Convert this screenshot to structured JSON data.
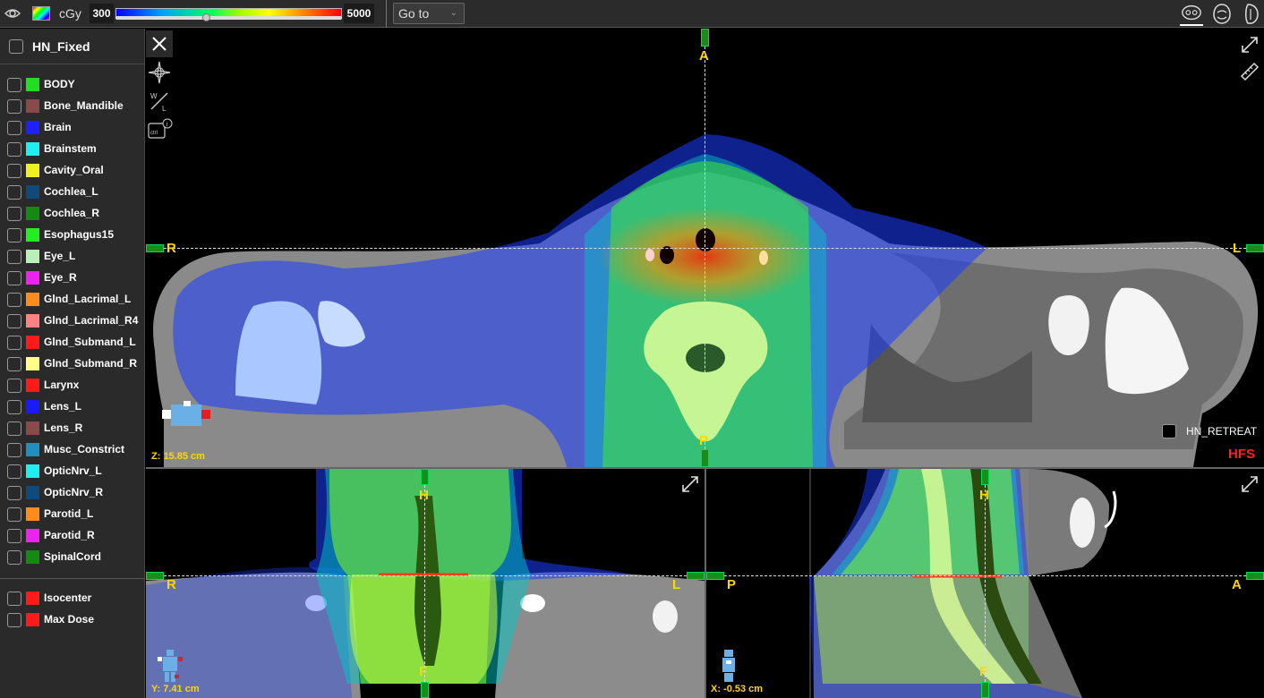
{
  "toolbar": {
    "unit": "cGy",
    "dose_min": "300",
    "dose_max": "5000",
    "slider_fraction": 0.4,
    "goto_label": "Go to",
    "view_icons": [
      "axial-view-icon",
      "coronal-view-icon",
      "sagittal-view-icon"
    ]
  },
  "sidebar": {
    "plan_name": "HN_Fixed",
    "structures": [
      {
        "label": "BODY",
        "color": "#22dd22"
      },
      {
        "label": "Bone_Mandible",
        "color": "#8b4a4a"
      },
      {
        "label": "Brain",
        "color": "#1f1fff"
      },
      {
        "label": "Brainstem",
        "color": "#22eeee"
      },
      {
        "label": "Cavity_Oral",
        "color": "#eeee22"
      },
      {
        "label": "Cochlea_L",
        "color": "#0f4a7a"
      },
      {
        "label": "Cochlea_R",
        "color": "#138a13"
      },
      {
        "label": "Esophagus15",
        "color": "#22ee22"
      },
      {
        "label": "Eye_L",
        "color": "#b8f0b8"
      },
      {
        "label": "Eye_R",
        "color": "#ee22ee"
      },
      {
        "label": "Glnd_Lacrimal_L",
        "color": "#ff8c1a"
      },
      {
        "label": "Glnd_Lacrimal_R4",
        "color": "#ff8080"
      },
      {
        "label": "Glnd_Submand_L",
        "color": "#ff1a1a"
      },
      {
        "label": "Glnd_Submand_R",
        "color": "#ffff88"
      },
      {
        "label": "Larynx",
        "color": "#ff1a1a"
      },
      {
        "label": "Lens_L",
        "color": "#1a1aff"
      },
      {
        "label": "Lens_R",
        "color": "#8b4a4a"
      },
      {
        "label": "Musc_Constrict",
        "color": "#1f8fbf"
      },
      {
        "label": "OpticNrv_L",
        "color": "#22eeee"
      },
      {
        "label": "OpticNrv_R",
        "color": "#0f4a7a"
      },
      {
        "label": "Parotid_L",
        "color": "#ff8c1a"
      },
      {
        "label": "Parotid_R",
        "color": "#ee22ee"
      },
      {
        "label": "SpinalCord",
        "color": "#138a13"
      }
    ],
    "points": [
      {
        "label": "Isocenter",
        "color": "#ff1a1a"
      },
      {
        "label": "Max Dose",
        "color": "#ff1a1a"
      }
    ]
  },
  "axial": {
    "orient_top": "A",
    "orient_bottom": "P",
    "orient_left": "R",
    "orient_right": "L",
    "position": "Z: 15.85 cm",
    "secondary_plan": "HN_RETREAT",
    "patient_position": "HFS"
  },
  "coronal": {
    "orient_top": "H",
    "orient_bottom": "F",
    "orient_left": "R",
    "orient_right": "L",
    "position": "Y: 7.41 cm"
  },
  "sagittal": {
    "orient_top": "H",
    "orient_bottom": "F",
    "orient_left": "P",
    "orient_right": "A",
    "position": "X: -0.53 cm"
  }
}
